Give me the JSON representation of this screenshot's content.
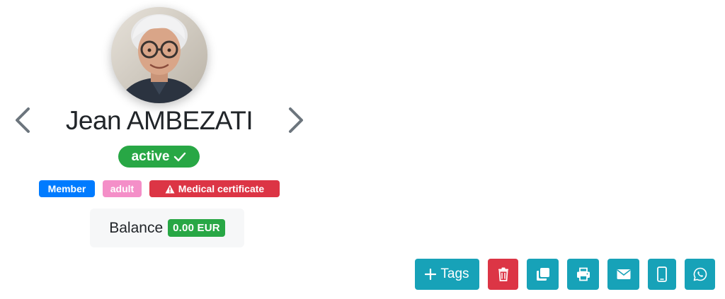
{
  "profile": {
    "name": "Jean AMBEZATI",
    "status": "active",
    "status_color": "#28a745"
  },
  "tags": [
    {
      "label": "Member",
      "color": "#007bff"
    },
    {
      "label": "adult",
      "color": "#f48fc8"
    },
    {
      "label": "Medical certificate",
      "color": "#dc3545",
      "icon": "warning-icon"
    }
  ],
  "balance": {
    "label": "Balance",
    "value": "0.00 EUR"
  },
  "navigation": {
    "prev_icon": "chevron-left-icon",
    "next_icon": "chevron-right-icon"
  },
  "actions": {
    "tags_label": "Tags",
    "buttons": [
      {
        "name": "add-tags",
        "icon": "plus-icon"
      },
      {
        "name": "delete",
        "icon": "trash-icon"
      },
      {
        "name": "duplicate",
        "icon": "copy-icon"
      },
      {
        "name": "print",
        "icon": "printer-icon"
      },
      {
        "name": "email",
        "icon": "envelope-icon"
      },
      {
        "name": "sms",
        "icon": "mobile-phone-icon"
      },
      {
        "name": "whatsapp",
        "icon": "whatsapp-icon"
      }
    ],
    "primary_color": "#17a2b8",
    "danger_color": "#dc3545"
  }
}
